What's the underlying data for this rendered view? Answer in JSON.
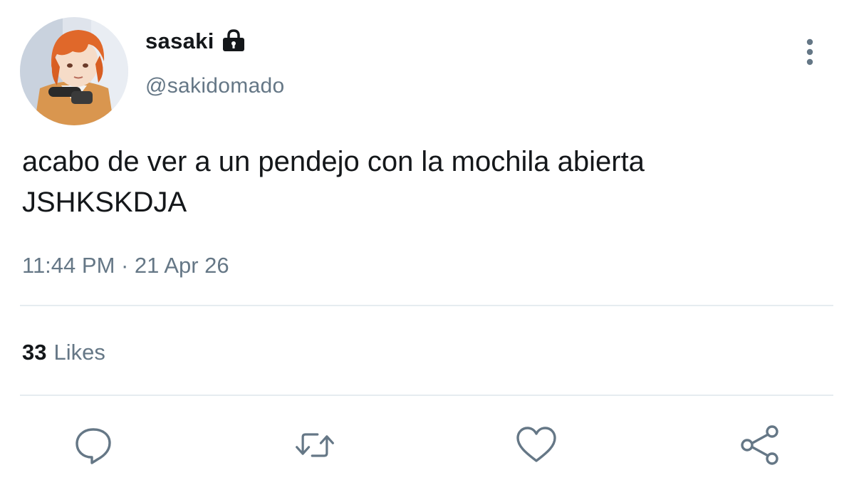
{
  "author": {
    "display_name": "sasaki",
    "handle": "@sakidomado",
    "protected_icon": "lock-icon",
    "avatar_icon": "avatar-anime-character"
  },
  "tweet": {
    "text": "acabo de ver a un pendejo con la mochila abierta\nJSHKSKDJA",
    "timestamp": "11:44 PM · 21 Apr 26"
  },
  "stats": {
    "likes_count": "33",
    "likes_label": "Likes"
  },
  "actions": {
    "reply_icon": "reply-icon",
    "retweet_icon": "retweet-icon",
    "like_icon": "heart-icon",
    "share_icon": "share-icon",
    "more_icon": "more-vertical-icon"
  },
  "colors": {
    "text_primary": "#14171a",
    "text_secondary": "#657786",
    "icon": "#657786",
    "divider": "#e6ecf0"
  }
}
